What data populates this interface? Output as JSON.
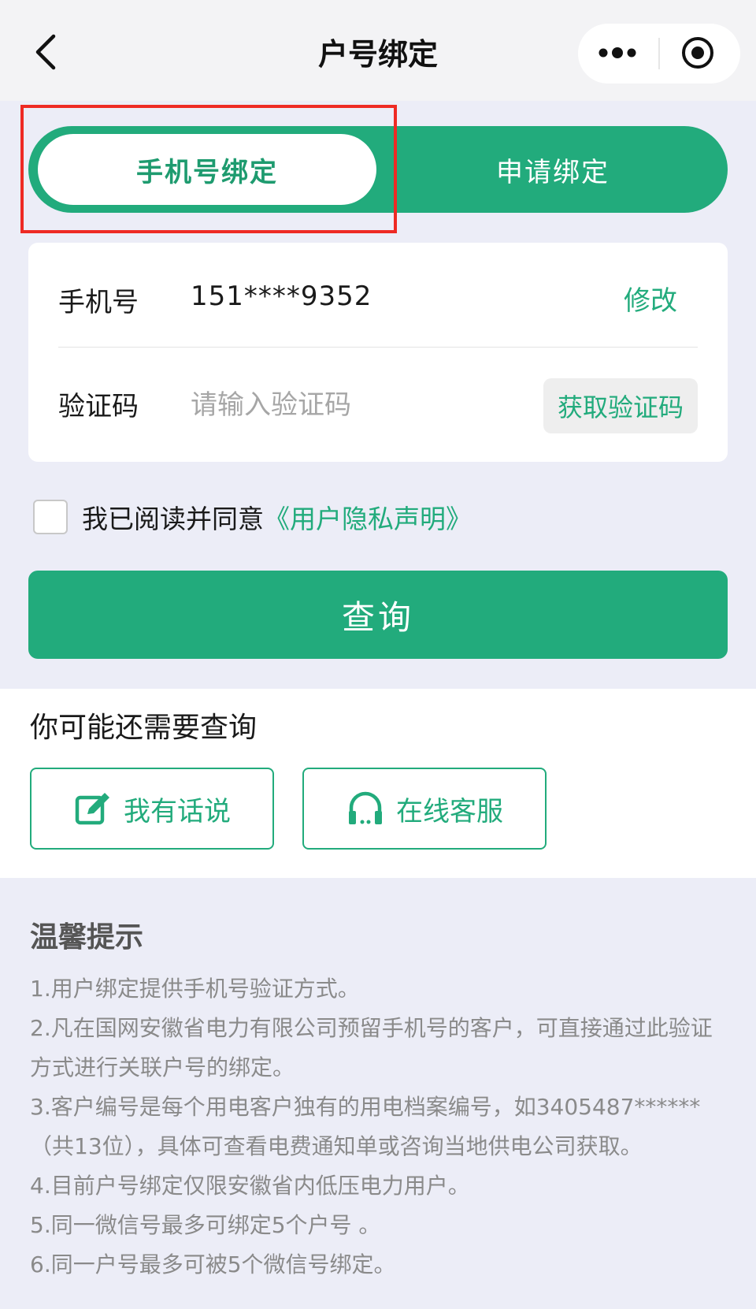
{
  "nav": {
    "title": "户号绑定"
  },
  "tabs": {
    "active": "手机号绑定",
    "inactive": "申请绑定"
  },
  "form": {
    "phone_label": "手机号",
    "phone_value": "151****9352",
    "modify_label": "修改",
    "code_label": "验证码",
    "code_placeholder": "请输入验证码",
    "code_value": "",
    "get_code_label": "获取验证码"
  },
  "agreement": {
    "text": "我已阅读并同意",
    "link": "《用户隐私声明》",
    "checked": false
  },
  "query_button": "查询",
  "more_section": {
    "title": "你可能还需要查询",
    "buttons": [
      {
        "label": "我有话说",
        "icon": "edit-icon"
      },
      {
        "label": "在线客服",
        "icon": "headset-icon"
      }
    ]
  },
  "tips": {
    "title": "温馨提示",
    "items": [
      "1.用户绑定提供手机号验证方式。",
      "2.凡在国网安徽省电力有限公司预留手机号的客户，可直接通过此验证方式进行关联户号的绑定。",
      "3.客户编号是每个用电客户独有的用电档案编号，如3405487******（共13位），具体可查看电费通知单或咨询当地供电公司获取。",
      "4.目前户号绑定仅限安徽省内低压电力用户。",
      "5.同一微信号最多可绑定5个户号 。",
      "6.同一户号最多可被5个微信号绑定。"
    ]
  },
  "colors": {
    "accent": "#22ab7c",
    "highlight": "#ee2a24",
    "background": "#ecedf7"
  }
}
